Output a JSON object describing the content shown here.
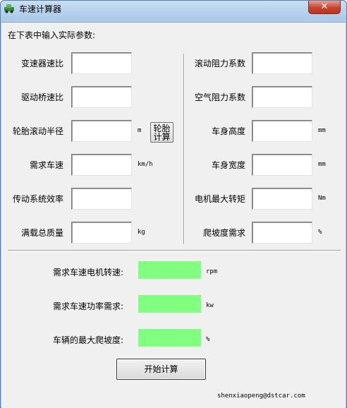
{
  "window": {
    "title": "车速计算器",
    "icon": "car-app-icon",
    "close_glyph": "✕"
  },
  "instruction": "在下表中输入实际参数:",
  "left_params": [
    {
      "label": "变速器速比",
      "unit": "",
      "value": ""
    },
    {
      "label": "驱动桥速比",
      "unit": "",
      "value": ""
    },
    {
      "label": "轮胎滚动半径",
      "unit": "m",
      "value": ""
    },
    {
      "label": "需求车速",
      "unit": "km/h",
      "value": ""
    },
    {
      "label": "传动系统效率",
      "unit": "",
      "value": ""
    },
    {
      "label": "满载总质量",
      "unit": "kg",
      "value": ""
    }
  ],
  "right_params": [
    {
      "label": "滚动阻力系数",
      "unit": "",
      "value": ""
    },
    {
      "label": "空气阻力系数",
      "unit": "",
      "value": ""
    },
    {
      "label": "车身高度",
      "unit": "mm",
      "value": ""
    },
    {
      "label": "车身宽度",
      "unit": "mm",
      "value": ""
    },
    {
      "label": "电机最大转矩",
      "unit": "Nm",
      "value": ""
    },
    {
      "label": "爬坡度需求",
      "unit": "%",
      "value": ""
    }
  ],
  "tire_button": {
    "line1": "轮胎",
    "line2": "计算"
  },
  "results": [
    {
      "label": "需求车速电机转速:",
      "unit": "rpm",
      "value": ""
    },
    {
      "label": "需求车速功率需求:",
      "unit": "kw",
      "value": ""
    },
    {
      "label": "车辆的最大爬坡度:",
      "unit": "%",
      "value": ""
    }
  ],
  "start_button": "开始计算",
  "footer_email": "shenxiaopeng@dstcar.com",
  "colors": {
    "result_fill": "#80ff80",
    "client_bg": "#f0f0f0",
    "titlebar": "#b0cde9",
    "close_button": "#c7432f"
  }
}
